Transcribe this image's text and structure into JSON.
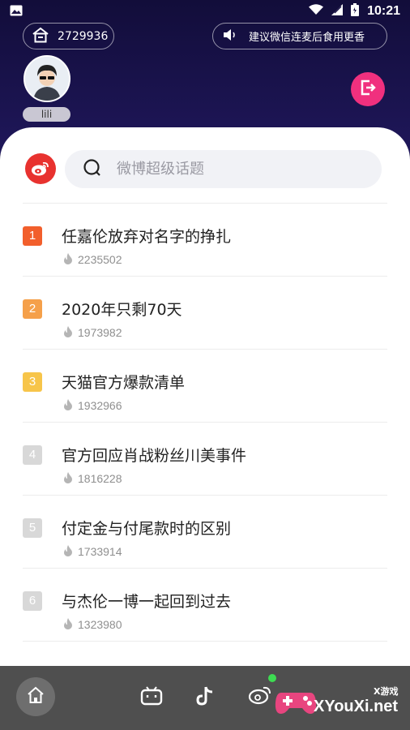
{
  "status_bar": {
    "time": "10:21"
  },
  "header": {
    "room_number": "2729936",
    "notice_text": "建议微信连麦后食用更香",
    "username": "lili"
  },
  "search": {
    "placeholder": "微博超级话题"
  },
  "topics": [
    {
      "rank": "1",
      "title": "任嘉伦放弃对名字的挣扎",
      "heat": "2235502",
      "color": "#f25f2c"
    },
    {
      "rank": "2",
      "title": "2020年只剩70天",
      "heat": "1973982",
      "color": "#f5a04a"
    },
    {
      "rank": "3",
      "title": "天猫官方爆款清单",
      "heat": "1932966",
      "color": "#f7c54a"
    },
    {
      "rank": "4",
      "title": "官方回应肖战粉丝川美事件",
      "heat": "1816228",
      "color": "#d8d8d8"
    },
    {
      "rank": "5",
      "title": "付定金与付尾款时的区别",
      "heat": "1733914",
      "color": "#d8d8d8"
    },
    {
      "rank": "6",
      "title": "与杰伦一博一起回到过去",
      "heat": "1323980",
      "color": "#d8d8d8"
    }
  ],
  "watermark": {
    "brand": "XYouXi.net",
    "tag": "X游戏"
  },
  "icons": {
    "image": "image-icon",
    "wifi": "wifi-icon",
    "signal": "signal-icon",
    "battery": "battery-icon",
    "home": "home-icon",
    "speaker": "speaker-icon",
    "exit": "exit-icon",
    "weibo": "weibo-icon",
    "search": "search-icon",
    "flame": "flame-icon",
    "bilibili": "bilibili-icon",
    "tiktok": "tiktok-icon"
  },
  "colors": {
    "header_bg": "#1b1445",
    "exit_button": "#f0307e",
    "weibo_red": "#e8322f",
    "active_dot": "#3ddc52"
  }
}
